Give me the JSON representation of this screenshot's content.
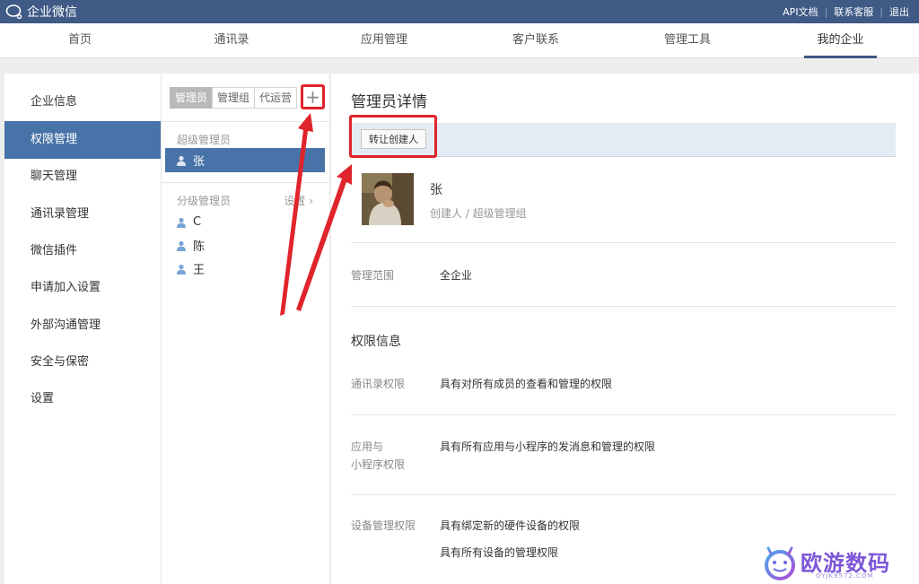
{
  "topbar": {
    "brand": "企业微信",
    "links": [
      "API文档",
      "联系客服",
      "退出"
    ]
  },
  "nav": {
    "items": [
      "首页",
      "通讯录",
      "应用管理",
      "客户联系",
      "管理工具",
      "我的企业"
    ],
    "active_index": 5
  },
  "sidebar": {
    "items": [
      "企业信息",
      "权限管理",
      "聊天管理",
      "通讯录管理",
      "微信插件",
      "申请加入设置",
      "外部沟通管理",
      "安全与保密",
      "设置"
    ],
    "active_index": 1
  },
  "admin_panel": {
    "tabs": [
      "管理员",
      "管理组",
      "代运营"
    ],
    "active_tab": 0,
    "add_symbol": "+",
    "super_admin_title": "超级管理员",
    "super_admins": [
      "张"
    ],
    "sub_admin_title": "分级管理员",
    "sub_admin_setting": "设置 ›",
    "sub_admins": [
      "C",
      "陈",
      "王"
    ]
  },
  "detail": {
    "title": "管理员详情",
    "transfer_button": "转让创建人",
    "name": "张",
    "role": "创建人 / 超级管理组",
    "scope_label": "管理范围",
    "scope_value": "全企业",
    "permissions_title": "权限信息",
    "contacts_label": "通讯录权限",
    "contacts_value": "具有对所有成员的查看和管理的权限",
    "apps_label_line1": "应用与",
    "apps_label_line2": "小程序权限",
    "apps_value": "具有所有应用与小程序的发消息和管理的权限",
    "device_label": "设备管理权限",
    "device_value_1": "具有绑定新的硬件设备的权限",
    "device_value_2": "具有所有设备的管理权限"
  },
  "watermark": {
    "text": "欧游数码",
    "sub": "OYJK8572.COM"
  },
  "colors": {
    "topbar": "#3e5a85",
    "active": "#4873a8",
    "highlight": "#e0242b"
  }
}
